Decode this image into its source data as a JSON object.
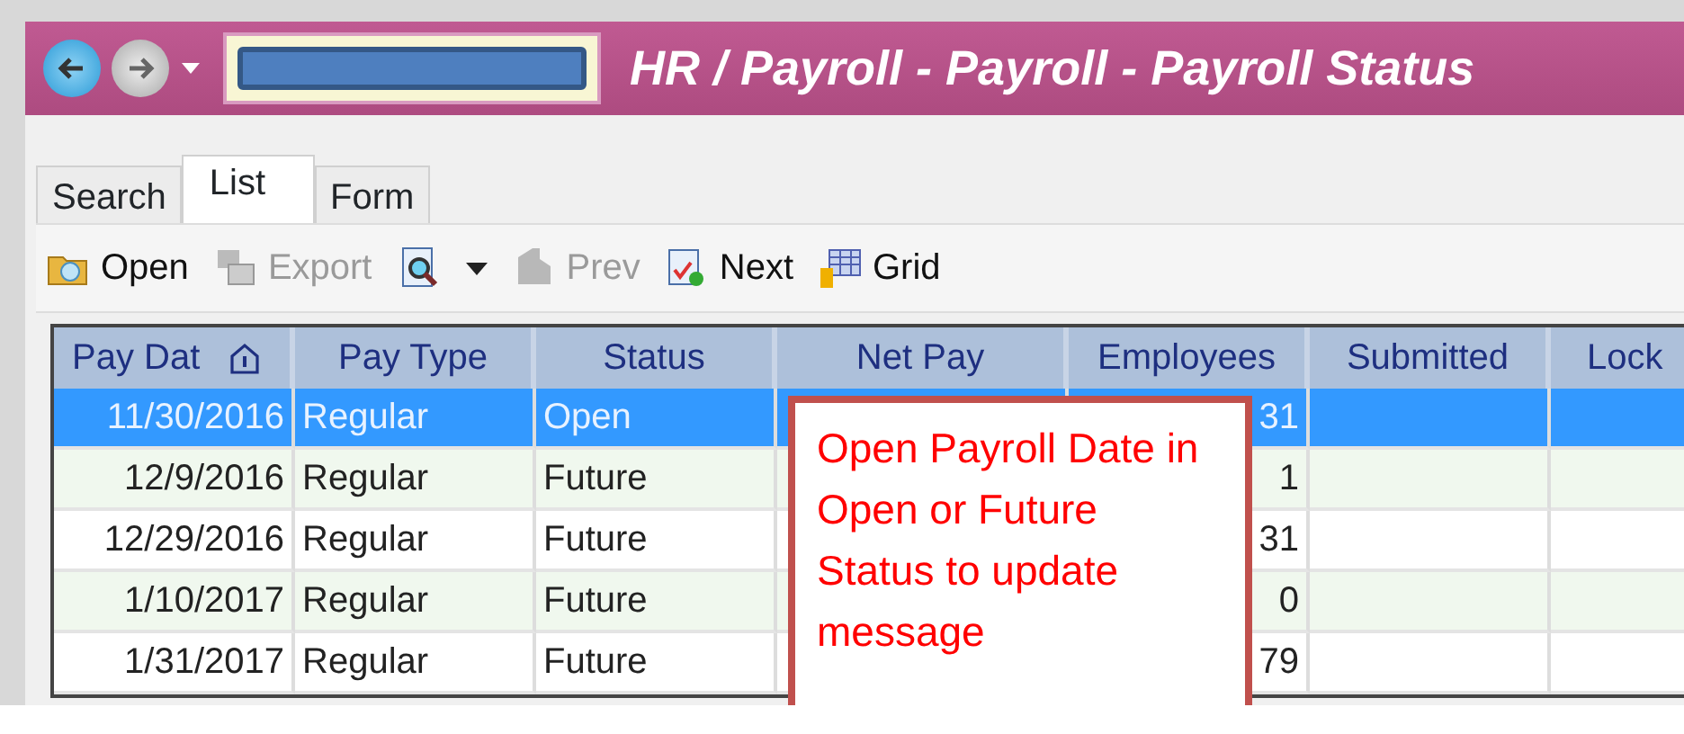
{
  "window": {
    "title": "HR / Payroll - Payroll - Payroll Status"
  },
  "tabs": [
    {
      "label": "Search",
      "selected": false
    },
    {
      "label": "List",
      "selected": true
    },
    {
      "label": "Form",
      "selected": false
    }
  ],
  "toolbar": [
    {
      "label": "Open",
      "kind": "folder",
      "disabled": false,
      "dropdown": false
    },
    {
      "label": "Export",
      "kind": "export",
      "disabled": true,
      "dropdown": false
    },
    {
      "kind": "preview",
      "disabled": false,
      "dropdown": true
    },
    {
      "label": "Prev",
      "kind": "prev",
      "disabled": true,
      "dropdown": false
    },
    {
      "label": "Next",
      "kind": "next",
      "disabled": false,
      "dropdown": false
    },
    {
      "label": "Grid",
      "kind": "grid",
      "disabled": false,
      "dropdown": false
    }
  ],
  "table": {
    "columns": [
      "Pay Dat",
      "Pay Type",
      "Status",
      "Net Pay",
      "Employees",
      "Submitted",
      "Lock"
    ],
    "rows": [
      {
        "selected": true,
        "cells": [
          "11/30/2016",
          "Regular",
          "Open",
          "",
          "31",
          "",
          ""
        ]
      },
      {
        "selected": false,
        "cells": [
          "12/9/2016",
          "Regular",
          "Future",
          "",
          "1",
          "",
          ""
        ]
      },
      {
        "selected": false,
        "cells": [
          "12/29/2016",
          "Regular",
          "Future",
          "",
          "31",
          "",
          ""
        ]
      },
      {
        "selected": false,
        "cells": [
          "1/10/2017",
          "Regular",
          "Future",
          "",
          "0",
          "",
          ""
        ]
      },
      {
        "selected": false,
        "cells": [
          "1/31/2017",
          "Regular",
          "Future",
          "",
          "79",
          "",
          ""
        ]
      }
    ]
  },
  "callout": {
    "text": "Open Payroll Date in Open or Future Status to update message"
  }
}
